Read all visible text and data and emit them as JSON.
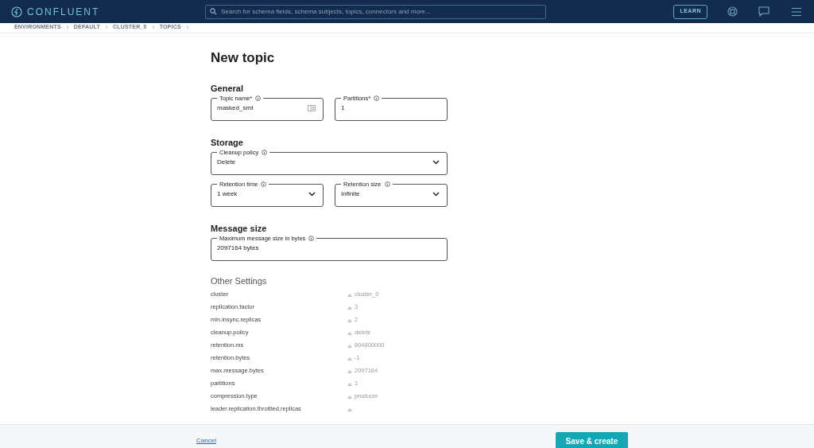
{
  "header": {
    "brand": "CONFLUENT",
    "search_placeholder": "Search for schema fields, schema subjects, topics, connectors and more...",
    "learn": "LEARN"
  },
  "breadcrumbs": [
    "ENVIRONMENTS",
    "DEFAULT",
    "CLUSTER_0",
    "TOPICS"
  ],
  "title": "New topic",
  "sections": [
    {
      "heading": "General",
      "rows": [
        [
          {
            "label": "Topic name*",
            "value": "masked_smt",
            "kind": "text",
            "icon": true
          },
          {
            "label": "Partitions*",
            "value": "1",
            "kind": "text",
            "icon": false
          }
        ]
      ]
    },
    {
      "heading": "Storage",
      "rows": [
        [
          {
            "label": "Cleanup policy",
            "value": "Delete",
            "kind": "select",
            "icon": false
          }
        ],
        [
          {
            "label": "Retention time",
            "value": "1 week",
            "kind": "select",
            "icon": false
          },
          {
            "label": "Retention size",
            "value": "Infinite",
            "kind": "select",
            "icon": false
          }
        ]
      ]
    },
    {
      "heading": "Message size",
      "rows": [
        [
          {
            "label": "Maximum message size in bytes",
            "value": "2097164 bytes",
            "kind": "text",
            "icon": false
          }
        ]
      ]
    }
  ],
  "other_settings": {
    "heading": "Other Settings",
    "rows": [
      {
        "key": "cluster",
        "value": "cluster_0"
      },
      {
        "key": "replication.factor",
        "value": "3"
      },
      {
        "key": "min.insync.replicas",
        "value": "2"
      },
      {
        "key": "cleanup.policy",
        "value": "delete"
      },
      {
        "key": "retention.ms",
        "value": "604800000"
      },
      {
        "key": "retention.bytes",
        "value": "-1"
      },
      {
        "key": "max.message.bytes",
        "value": "2097164"
      },
      {
        "key": "partitions",
        "value": "1"
      },
      {
        "key": "compression.type",
        "value": "producer"
      },
      {
        "key": "leader.replication.throttled.replicas",
        "value": ""
      }
    ]
  },
  "footer": {
    "cancel": "Cancel",
    "submit": "Save & create"
  }
}
